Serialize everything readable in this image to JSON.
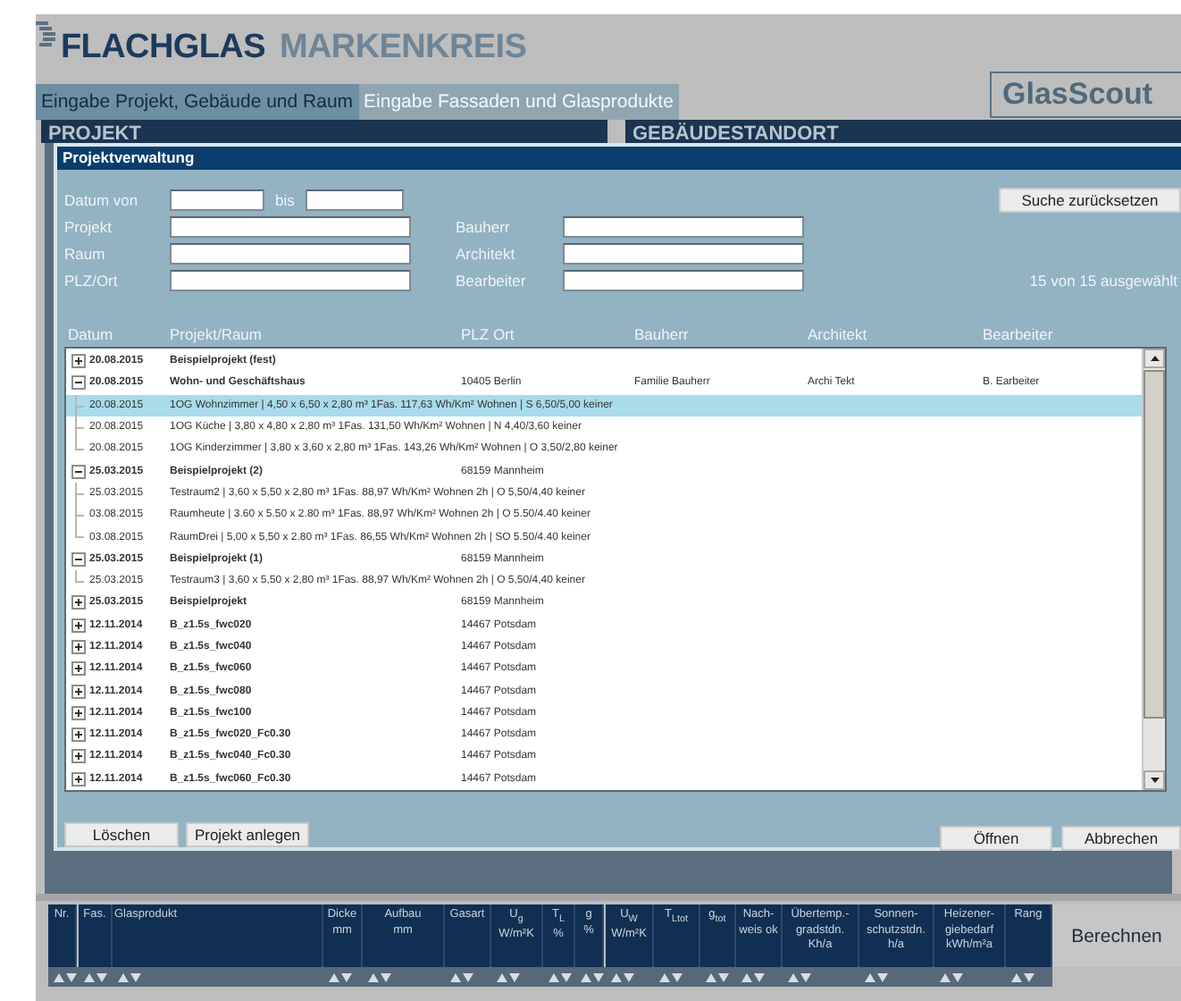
{
  "brand": {
    "primary": "FLACHGLAS",
    "secondary": "MARKENKREIS"
  },
  "app_badge": "GlasScout",
  "tabs": [
    {
      "label": "Eingabe Projekt, Gebäude und Raum",
      "selected": true
    },
    {
      "label": "Eingabe Fassaden und Glasprodukte",
      "selected": false
    }
  ],
  "panels": [
    "PROJEKT",
    "GEBÄUDESTANDORT"
  ],
  "dialog": {
    "title": "Projektverwaltung",
    "filters": {
      "date_from": "Datum von",
      "date_to": "bis",
      "project": "Projekt",
      "room": "Raum",
      "place": "PLZ/Ort",
      "builder": "Bauherr",
      "architect": "Architekt",
      "editor": "Bearbeiter"
    },
    "reset_button": "Suche zurücksetzen",
    "count": "15 von 15 ausgewählt",
    "columns": [
      "Datum",
      "Projekt/Raum",
      "PLZ Ort",
      "Bauherr",
      "Architekt",
      "Bearbeiter"
    ],
    "projects": [
      {
        "date": "20.08.2015",
        "name": "Beispielprojekt (fest)",
        "expanded": false
      },
      {
        "date": "20.08.2015",
        "name": "Wohn- und Geschäftshaus",
        "location": "10405 Berlin",
        "builder": "Familie Bauherr",
        "architect": "Archi Tekt",
        "editor": "B. Earbeiter",
        "expanded": true,
        "children": [
          {
            "date": "20.08.2015",
            "text": "1OG Wohnzimmer | 4,50 x 6,50 x 2,80 m³ 1Fas. 117,63 Wh/Km² Wohnen | S 6,50/5,00 keiner",
            "selected": true
          },
          {
            "date": "20.08.2015",
            "text": "1OG Küche | 3,80 x 4,80 x 2,80 m³ 1Fas. 131,50 Wh/Km² Wohnen | N 4,40/3,60 keiner",
            "selected": false
          },
          {
            "date": "20.08.2015",
            "text": "1OG Kinderzimmer | 3,80 x 3,60 x 2,80 m³ 1Fas. 143,26 Wh/Km² Wohnen | O 3,50/2,80 keiner",
            "selected": false
          }
        ]
      },
      {
        "date": "25.03.2015",
        "name": "Beispielprojekt (2)",
        "location": "68159 Mannheim",
        "expanded": true,
        "children": [
          {
            "date": "25.03.2015",
            "text": "Testraum2 | 3,60 x 5,50 x 2,80 m³ 1Fas. 88,97 Wh/Km² Wohnen 2h | O 5,50/4,40 keiner",
            "selected": false
          },
          {
            "date": "03.08.2015",
            "text": "Raumheute | 3.60 x 5.50 x 2.80 m³ 1Fas. 88,97 Wh/Km² Wohnen 2h | O 5.50/4.40 keiner",
            "selected": false
          },
          {
            "date": "03.08.2015",
            "text": "RaumDrei | 5,00 x 5,50 x 2.80 m³ 1Fas. 86,55 Wh/Km² Wohnen 2h | SO 5.50/4.40 keiner",
            "selected": false
          }
        ]
      },
      {
        "date": "25.03.2015",
        "name": "Beispielprojekt (1)",
        "location": "68159 Mannheim",
        "expanded": true,
        "children": [
          {
            "date": "25.03.2015",
            "text": "Testraum3 | 3,60 x 5,50 x 2,80 m³ 1Fas. 88,97 Wh/Km² Wohnen 2h | O 5,50/4,40 keiner",
            "selected": false
          }
        ]
      },
      {
        "date": "25.03.2015",
        "name": "Beispielprojekt",
        "location": "68159 Mannheim",
        "expanded": false
      },
      {
        "date": "12.11.2014",
        "name": "B_z1.5s_fwc020",
        "location": "14467 Potsdam",
        "expanded": false
      },
      {
        "date": "12.11.2014",
        "name": "B_z1.5s_fwc040",
        "location": "14467 Potsdam",
        "expanded": false
      },
      {
        "date": "12.11.2014",
        "name": "B_z1.5s_fwc060",
        "location": "14467 Potsdam",
        "expanded": false
      },
      {
        "date": "12.11.2014",
        "name": "B_z1.5s_fwc080",
        "location": "14467 Potsdam",
        "expanded": false
      },
      {
        "date": "12.11.2014",
        "name": "B_z1.5s_fwc100",
        "location": "14467 Potsdam",
        "expanded": false
      },
      {
        "date": "12.11.2014",
        "name": "B_z1.5s_fwc020_Fc0.30",
        "location": "14467 Potsdam",
        "expanded": false
      },
      {
        "date": "12.11.2014",
        "name": "B_z1.5s_fwc040_Fc0.30",
        "location": "14467 Potsdam",
        "expanded": false
      },
      {
        "date": "12.11.2014",
        "name": "B_z1.5s_fwc060_Fc0.30",
        "location": "14467 Potsdam",
        "expanded": false
      }
    ],
    "left_buttons": [
      "Löschen",
      "Projekt anlegen"
    ],
    "right_buttons": [
      "Öffnen",
      "Abbrechen"
    ]
  },
  "results_table": {
    "columns": [
      {
        "label": "Nr."
      },
      {
        "label": "Fas."
      },
      {
        "label": "Glasprodukt"
      },
      {
        "label": "Dicke\nmm"
      },
      {
        "label": "Aufbau\nmm"
      },
      {
        "label": "Gasart"
      },
      {
        "label": "U$_{g}$\nW/m²K"
      },
      {
        "label": "T$_{L}$\n%"
      },
      {
        "label": "g\n%"
      },
      {
        "label": "U$_{W}$\nW/m²K"
      },
      {
        "label": "T$_{Ltot}$"
      },
      {
        "label": "g$_{tot}$"
      },
      {
        "label": "Nach-\nweis ok"
      },
      {
        "label": "Übertemp.-\ngradstdn.\nKh/a"
      },
      {
        "label": "Sonnen-\nschutzstdn.\nh/a"
      },
      {
        "label": "Heizener-\ngiebedarf\nkWh/m²a"
      },
      {
        "label": "Rang"
      }
    ],
    "calculate_button": "Berechnen"
  }
}
